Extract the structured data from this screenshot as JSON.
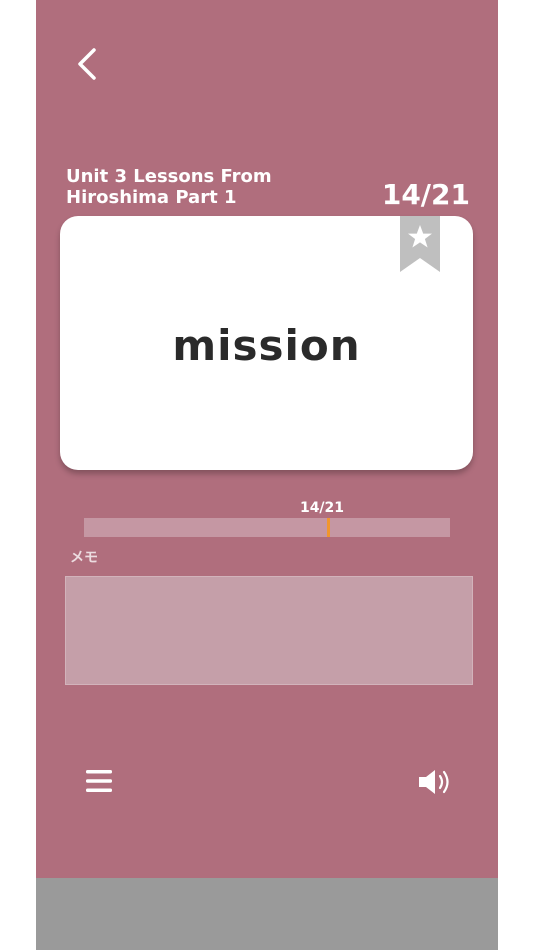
{
  "header": {
    "back_icon": "chevron-left-icon"
  },
  "lesson": {
    "title": "Unit 3 Lessons From\nHiroshima Part 1",
    "counter": "14/21"
  },
  "card": {
    "word": "mission",
    "bookmark_icon": "star-bookmark-icon"
  },
  "progress": {
    "label": "14/21",
    "current": 14,
    "total": 21,
    "marker_color": "#f0962e"
  },
  "memo": {
    "label": "メモ",
    "value": ""
  },
  "footer": {
    "menu_icon": "hamburger-menu-icon",
    "sound_icon": "speaker-icon"
  },
  "colors": {
    "background": "#b06e7d",
    "card": "#ffffff",
    "bottom_bar": "#9a9a9a"
  }
}
